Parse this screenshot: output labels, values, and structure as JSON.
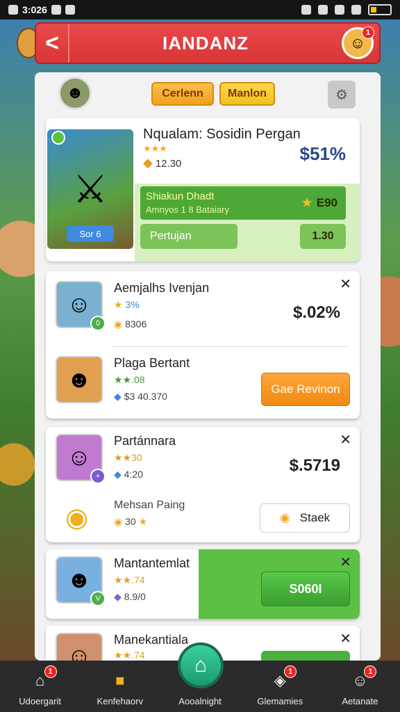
{
  "status_bar": {
    "time": "3:026"
  },
  "header": {
    "title": "IANDANZ",
    "back_glyph": "<",
    "avatar_badge": "1"
  },
  "tabs": {
    "tab1": "Cerlenn",
    "tab2": "Manlon"
  },
  "featured": {
    "title": "Nqualam: Sosidin Pergan",
    "stars": "★★★",
    "gem_value": "12.30",
    "price": "$51%",
    "art_tag": "Sor 6",
    "promo_title": "Shiakun Dhadt",
    "promo_sub": "Amnyos 1 8 Bataiary",
    "promo_value": "E90",
    "left_button": "Pertujan",
    "right_button": "1.30"
  },
  "cards": [
    {
      "name": "Aemjalhs Ivenjan",
      "rating": "3%",
      "coins": "8306",
      "price": "$.02%"
    },
    {
      "name": "Plaga Bertant",
      "rating": "★★.08",
      "coins": "$3 40.370",
      "button": "Gae Revinon"
    },
    {
      "name": "Partánnara",
      "rating": "★★30",
      "coins": "4:20",
      "price": "$.5719"
    },
    {
      "name": "Mehsan Paing",
      "coins": "30",
      "button": "Staek"
    },
    {
      "name": "Mantantemlat",
      "rating": "★★.74",
      "coins": "8.9/0",
      "button": "S060I"
    },
    {
      "name": "Manekantiala",
      "rating": "★★.74"
    }
  ],
  "nav": [
    {
      "label": "Udoergarit",
      "badge": "1"
    },
    {
      "label": "Kenfehaorv",
      "badge": ""
    },
    {
      "label": "Aooalnight",
      "badge": ""
    },
    {
      "label": "Glemamies",
      "badge": "1"
    },
    {
      "label": "Aetanate",
      "badge": "1"
    }
  ],
  "colors": {
    "header_red": "#d93636",
    "accent_orange": "#f08a10",
    "accent_green": "#4ea838",
    "price_blue": "#2a4a8a"
  }
}
